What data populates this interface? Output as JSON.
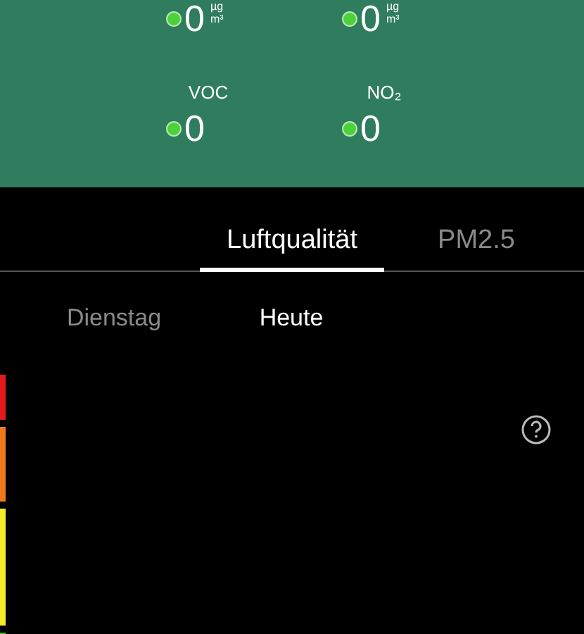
{
  "metrics": [
    {
      "value": "0",
      "unit_top": "µg",
      "unit_bottom": "m³",
      "color": "#4cd13a"
    },
    {
      "value": "0",
      "unit_top": "µg",
      "unit_bottom": "m³",
      "color": "#4cd13a"
    },
    {
      "label": "VOC",
      "value": "0",
      "color": "#4cd13a"
    },
    {
      "label": "NO₂",
      "value": "0",
      "color": "#4cd13a"
    }
  ],
  "tabs": [
    {
      "label": "Luftqualität",
      "selected": true
    },
    {
      "label": "PM2.5",
      "selected": false
    }
  ],
  "days": [
    {
      "label": "Dienstag",
      "selected": false
    },
    {
      "label": "Heute",
      "selected": true
    }
  ],
  "scale": [
    {
      "color": "#e5191c"
    },
    {
      "color": "#ee7a1c"
    },
    {
      "color": "#f2ec2a"
    },
    {
      "color": "#3dbb3a"
    }
  ]
}
